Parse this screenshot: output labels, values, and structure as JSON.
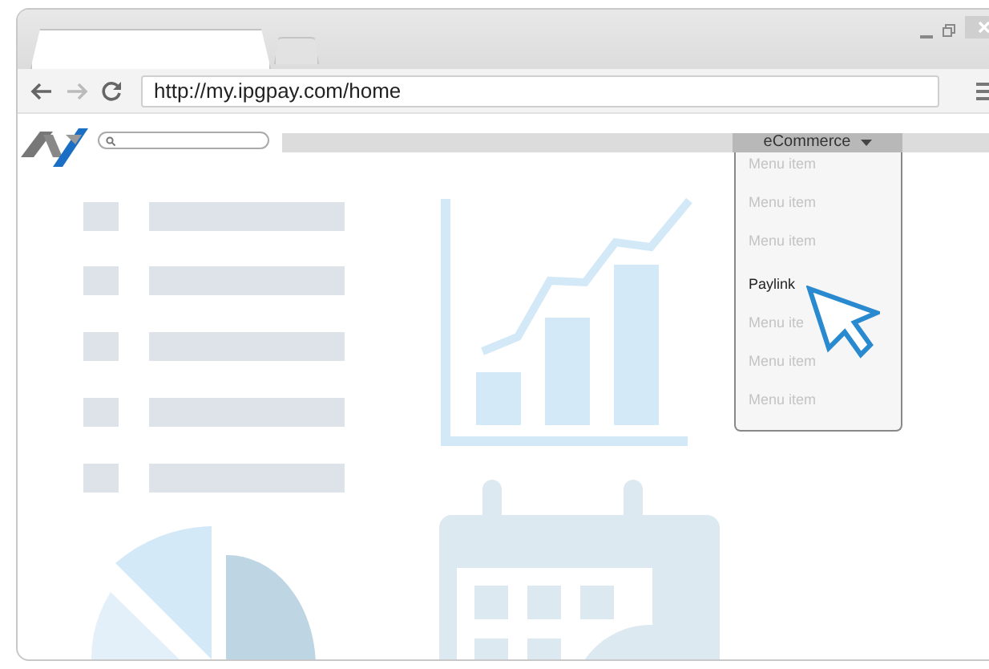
{
  "browser": {
    "tabs": [
      {
        "selected": true
      },
      {
        "selected": false
      }
    ],
    "navigation": {
      "back_disabled": false,
      "forward_disabled": true
    },
    "address_bar": {
      "url": "http://my.ipgpay.com/home"
    }
  },
  "nav": {
    "menu": {
      "label": "eCommerce",
      "expanded": true,
      "items": [
        {
          "label": "Menu item",
          "selected": false
        },
        {
          "label": "Menu item",
          "selected": false
        },
        {
          "label": "Menu item",
          "selected": false
        },
        {
          "label": "Paylink",
          "selected": true
        },
        {
          "label": "Menu ite",
          "selected": false
        },
        {
          "label": "Menu item",
          "selected": false
        },
        {
          "label": "Menu item",
          "selected": false
        }
      ]
    }
  }
}
